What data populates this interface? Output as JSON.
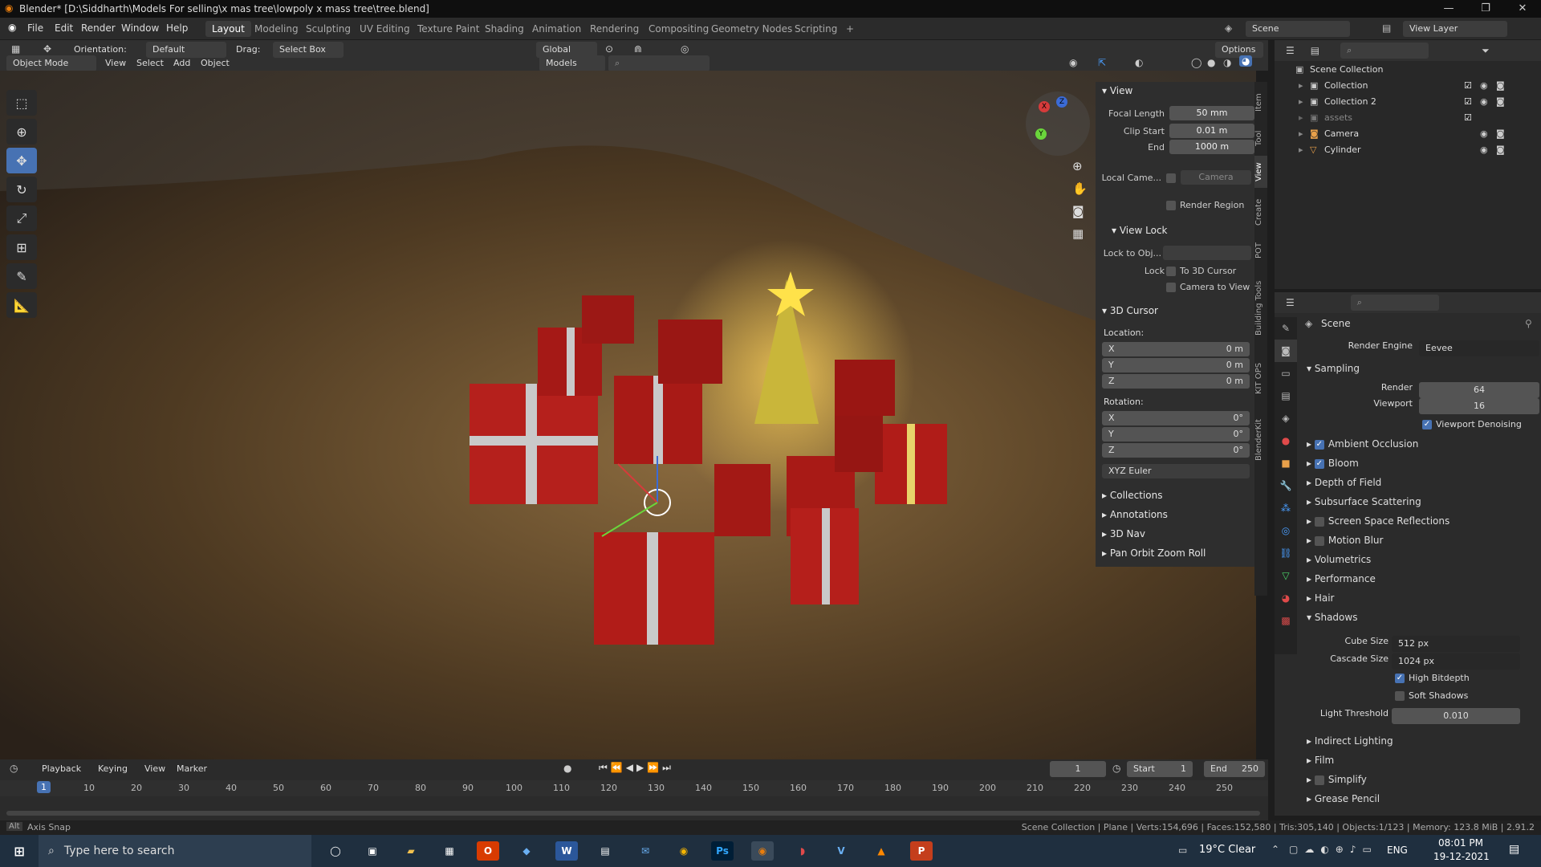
{
  "window": {
    "title": "Blender* [D:\\Siddharth\\Models For selling\\x mas tree\\lowpoly x mass tree\\tree.blend]",
    "minimize": "—",
    "maximize": "❐",
    "close": "✕"
  },
  "menu": [
    "File",
    "Edit",
    "Render",
    "Window",
    "Help"
  ],
  "workspaces": [
    "Layout",
    "Modeling",
    "Sculpting",
    "UV Editing",
    "Texture Paint",
    "Shading",
    "Animation",
    "Rendering",
    "Compositing",
    "Geometry Nodes",
    "Scripting",
    "+"
  ],
  "scene": {
    "name": "Scene",
    "view_layer": "View Layer"
  },
  "viewport_header": {
    "orientation_label": "Orientation:",
    "orientation_value": "Default",
    "drag_label": "Drag:",
    "drag_value": "Select Box",
    "transform": "Global",
    "options": "Options",
    "mode": "Object Mode",
    "view": "View",
    "select": "Select",
    "add": "Add",
    "object": "Object",
    "models": "Models"
  },
  "npanel": {
    "view_title": "View",
    "focal_length_label": "Focal Length",
    "focal_length": "50 mm",
    "clip_start_label": "Clip Start",
    "clip_start": "0.01 m",
    "end_label": "End",
    "end": "1000 m",
    "local_camera_label": "Local Came...",
    "local_camera": "Camera",
    "render_region": "Render Region",
    "view_lock_title": "View Lock",
    "lock_to_obj_label": "Lock to Obj...",
    "lock_label": "Lock",
    "to_3d_cursor": "To 3D Cursor",
    "camera_to_view": "Camera to View",
    "cursor_title": "3D Cursor",
    "location_label": "Location:",
    "loc_x": "0 m",
    "loc_y": "0 m",
    "loc_z": "0 m",
    "rotation_label": "Rotation:",
    "rot_x": "0°",
    "rot_y": "0°",
    "rot_z": "0°",
    "rotation_mode": "XYZ Euler",
    "axis_x": "X",
    "axis_y": "Y",
    "axis_z": "Z",
    "collections": "Collections",
    "annotations": "Annotations",
    "nav3d": "3D Nav",
    "pan_orbit": "Pan Orbit Zoom Roll"
  },
  "vtabs": [
    "Item",
    "Tool",
    "View",
    "Create",
    "POT",
    "Building Tools",
    "KIT OPS",
    "BlenderKit"
  ],
  "outliner": {
    "root": "Scene Collection",
    "items": [
      "Collection",
      "Collection 2",
      "assets",
      "Camera",
      "Cylinder"
    ]
  },
  "properties": {
    "scene_label": "Scene",
    "render_engine_label": "Render Engine",
    "render_engine": "Eevee",
    "sampling": "Sampling",
    "render_label": "Render",
    "render_samples": "64",
    "viewport_label": "Viewport",
    "viewport_samples": "16",
    "viewport_denoising": "Viewport Denoising",
    "sections": [
      "Ambient Occlusion",
      "Bloom",
      "Depth of Field",
      "Subsurface Scattering",
      "Screen Space Reflections",
      "Motion Blur",
      "Volumetrics",
      "Performance",
      "Hair",
      "Shadows"
    ],
    "cube_size_label": "Cube Size",
    "cube_size": "512 px",
    "cascade_size_label": "Cascade Size",
    "cascade_size": "1024 px",
    "high_bitdepth": "High Bitdepth",
    "soft_shadows": "Soft Shadows",
    "light_threshold_label": "Light Threshold",
    "light_threshold": "0.010",
    "sections2": [
      "Indirect Lighting",
      "Film",
      "Simplify",
      "Grease Pencil"
    ]
  },
  "timeline": {
    "playback": "Playback",
    "keying": "Keying",
    "view": "View",
    "marker": "Marker",
    "current_frame": "1",
    "start_label": "Start",
    "start": "1",
    "end_label": "End",
    "end": "250",
    "ticks": [
      "1",
      "10",
      "20",
      "30",
      "40",
      "50",
      "60",
      "70",
      "80",
      "90",
      "100",
      "110",
      "120",
      "130",
      "140",
      "150",
      "160",
      "170",
      "180",
      "190",
      "200",
      "210",
      "220",
      "230",
      "240",
      "250"
    ]
  },
  "status": {
    "left": "Axis Snap",
    "right": "Scene Collection | Plane | Verts:154,696 | Faces:152,580 | Tris:305,140 | Objects:1/123 | Memory: 123.8 MiB | 2.91.2"
  },
  "taskbar": {
    "search_placeholder": "Type here to search",
    "weather": "19°C  Clear",
    "lang": "ENG",
    "time": "08:01 PM",
    "date": "19-12-2021"
  }
}
